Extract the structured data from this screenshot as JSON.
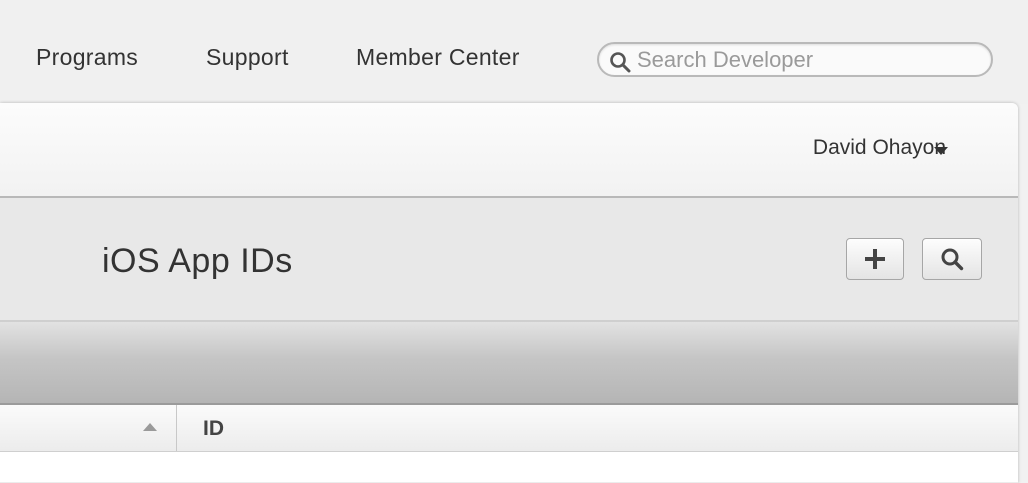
{
  "nav": {
    "items": [
      {
        "label": "Programs"
      },
      {
        "label": "Support"
      },
      {
        "label": "Member Center"
      }
    ],
    "search": {
      "placeholder": "Search Developer",
      "icon": "search-icon"
    }
  },
  "user": {
    "name": "David Ohayon",
    "menu_icon": "caret-down-icon"
  },
  "page": {
    "title": "iOS App IDs",
    "actions": [
      {
        "icon": "plus-icon"
      },
      {
        "icon": "search-icon"
      }
    ]
  },
  "table": {
    "columns": [
      {
        "label": "",
        "sort": "ascending"
      },
      {
        "label": "ID"
      }
    ]
  }
}
